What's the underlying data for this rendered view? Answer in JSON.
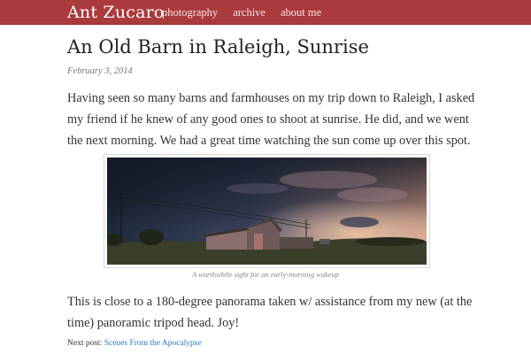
{
  "header": {
    "site_title": "Ant Zucaro",
    "nav": [
      {
        "label": "photography"
      },
      {
        "label": "archive"
      },
      {
        "label": "about me"
      }
    ],
    "bar_color": "#ab3a3d"
  },
  "post": {
    "title": "An Old Barn in Raleigh, Sunrise",
    "date": "February 3, 2014",
    "paragraph_1": "Having seen so many barns and farmhouses on my trip down to Raleigh, I asked my friend if he knew of any good ones to shoot at sunrise. He did, and we went the next morning. We had a great time watching the sun come up over this spot.",
    "image_caption": "A worthwhile sight for an early-morning wakeup",
    "paragraph_2": "This is close to a 180-degree panorama taken w/ assistance from my new (at the time) panoramic tripod head. Joy!",
    "next_post_label": "Next post:",
    "next_post_link": "Scenes From the Apocalypse",
    "link_color": "#2a7bb5"
  }
}
